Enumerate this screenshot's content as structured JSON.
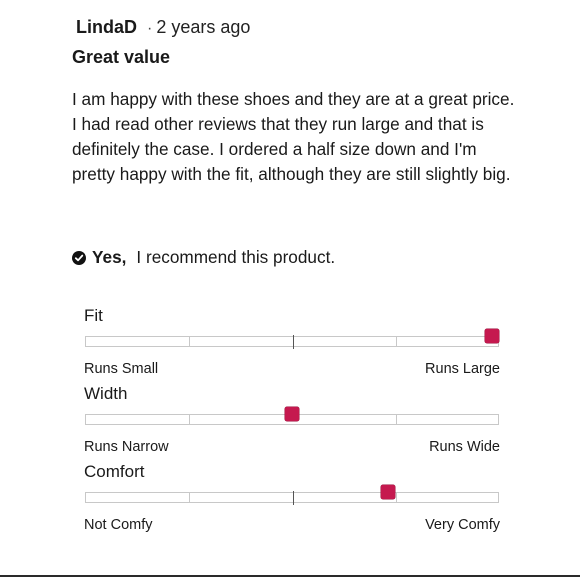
{
  "review": {
    "author": "LindaD",
    "separator": "·",
    "time_ago": "2 years ago",
    "title": "Great value",
    "body": "I am happy with these shoes and they are at a great price. I had read other reviews that they run large and that is definitely the case. I ordered a half size down and I'm pretty happy with the fit, although they are still slightly big.",
    "recommend_answer": "Yes,",
    "recommend_text": "I recommend this product.",
    "check_icon": "check-circle-icon"
  },
  "ratings": [
    {
      "name": "Fit",
      "left_label": "Runs Small",
      "right_label": "Runs Large",
      "value": 1.0,
      "show_mid": true
    },
    {
      "name": "Width",
      "left_label": "Runs Narrow",
      "right_label": "Runs Wide",
      "value": 0.5,
      "show_mid": false
    },
    {
      "name": "Comfort",
      "left_label": "Not Comfy",
      "right_label": "Very Comfy",
      "value": 0.74,
      "show_mid": true
    }
  ],
  "colors": {
    "marker": "#c5194f",
    "track_border": "#c8c8c8",
    "text": "#1a1a1a"
  }
}
